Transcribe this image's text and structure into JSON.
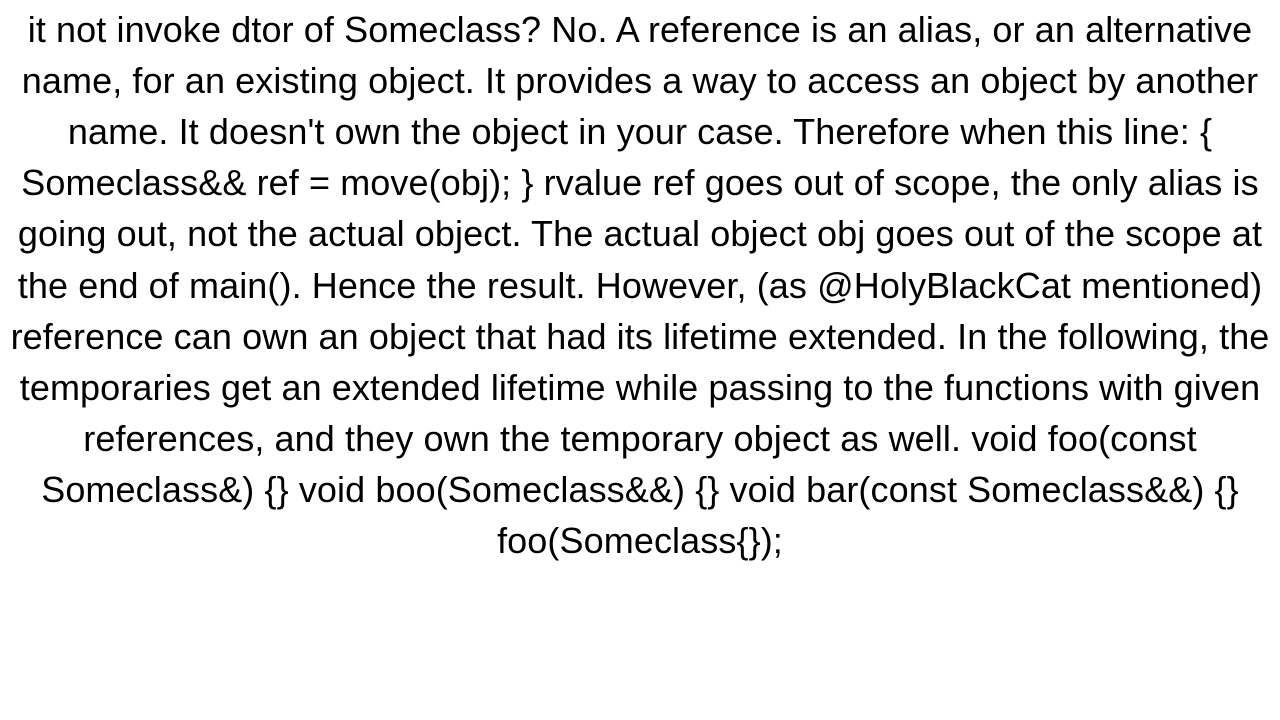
{
  "body": {
    "text": "it not invoke dtor of Someclass?  No. A reference is an alias, or an alternative name, for an existing object. It provides a way to access an object by another name. It doesn't own the object in your case. Therefore when this line: {     Someclass&& ref = move(obj); }  rvalue ref goes out of scope, the only alias is going out, not the actual object. The actual object obj goes out of the scope at the end of main(). Hence the result.  However, (as @HolyBlackCat mentioned) reference can own an object that had its lifetime extended. In the following, the temporaries get an extended lifetime while passing to the functions with given references, and they own the temporary object as well. void foo(const Someclass&) {} void boo(Someclass&&) {} void bar(const Someclass&&) {}  foo(Someclass{});"
  }
}
